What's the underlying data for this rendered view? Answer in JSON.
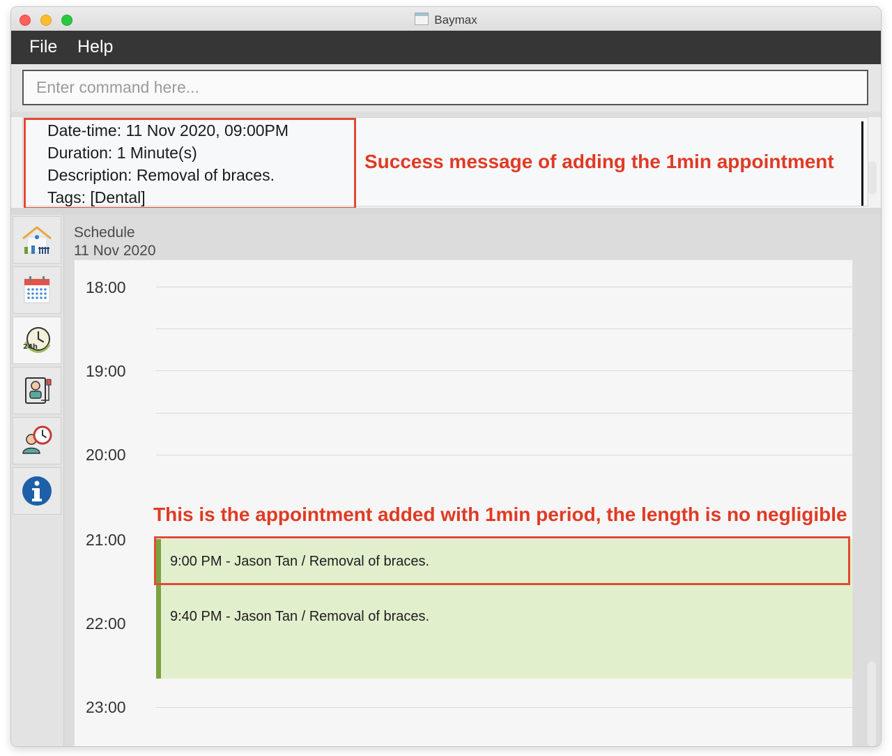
{
  "window": {
    "title": "Baymax"
  },
  "menu": {
    "items": [
      "File",
      "Help"
    ]
  },
  "command_box": {
    "placeholder": "Enter command here...",
    "value": ""
  },
  "result_display": {
    "lines": [
      "Date-time: 11 Nov 2020, 09:00PM",
      "Duration: 1 Minute(s)",
      "Description: Removal of braces.",
      "Tags: [Dental]"
    ]
  },
  "annotations": {
    "success_note": "Success message of adding the 1min appointment",
    "appointment_note": "This is the appointment added with 1min period, the length is no negligible",
    "color": "#e24a34"
  },
  "sidebar": {
    "tabs": [
      {
        "name": "dashboard",
        "icon": "home-icon",
        "active": false
      },
      {
        "name": "calendar",
        "icon": "calendar-icon",
        "active": false
      },
      {
        "name": "schedule",
        "icon": "clock-24h-icon",
        "active": true
      },
      {
        "name": "patients",
        "icon": "patient-record-icon",
        "active": false
      },
      {
        "name": "appointments",
        "icon": "doctor-clock-icon",
        "active": false
      },
      {
        "name": "info",
        "icon": "info-icon",
        "active": false
      }
    ]
  },
  "schedule": {
    "title": "Schedule",
    "date": "11 Nov 2020",
    "hours": [
      "18:00",
      "19:00",
      "20:00",
      "21:00",
      "22:00",
      "23:00"
    ],
    "appointments": [
      {
        "label": "9:00 PM - Jason Tan / Removal of braces.",
        "start": "21:00",
        "duration_minutes": 1
      },
      {
        "label": "9:40 PM - Jason Tan / Removal of braces.",
        "start": "21:40",
        "duration_minutes": 60
      }
    ],
    "appointment_color": "#e2efcd",
    "appointment_accent": "#7aa33f"
  }
}
